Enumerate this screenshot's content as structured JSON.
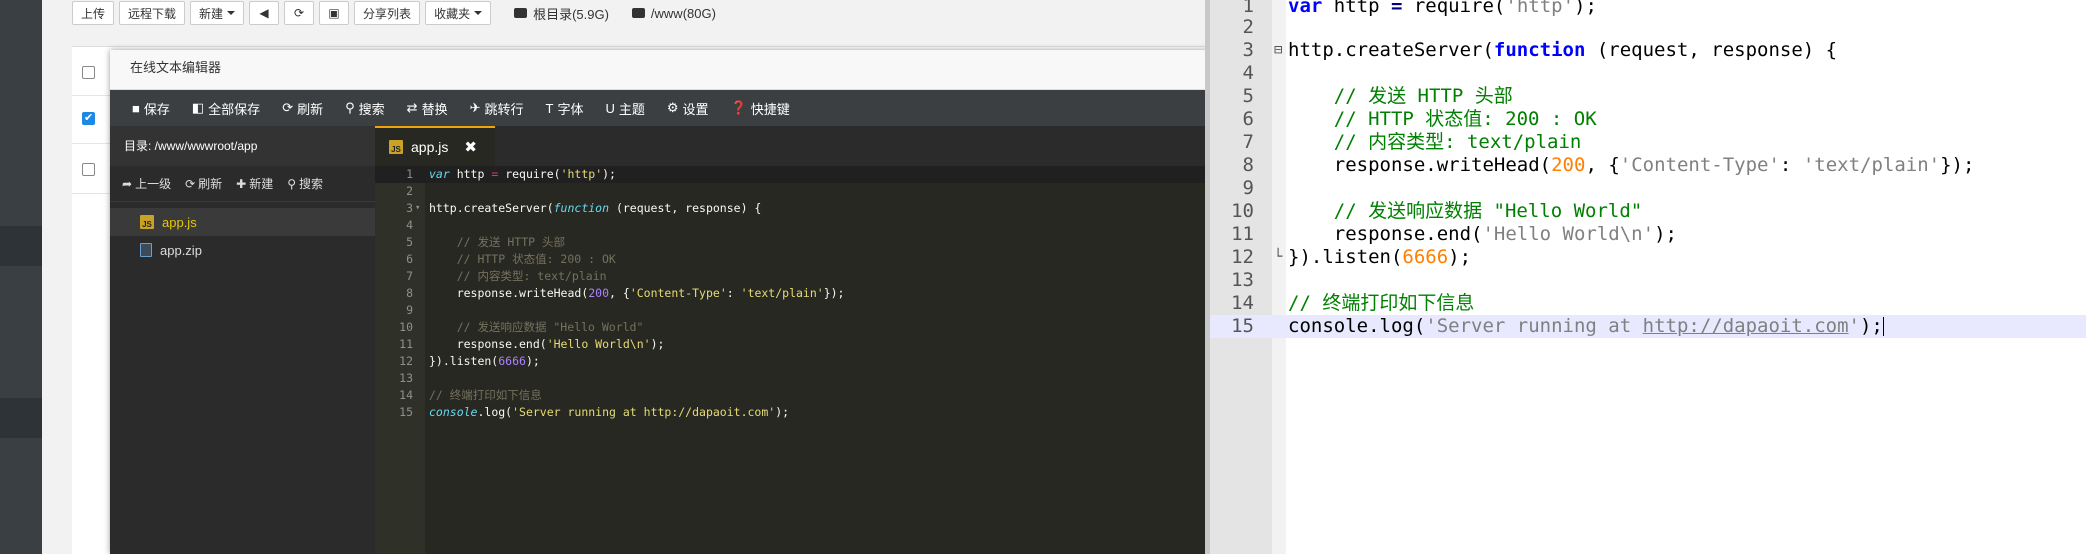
{
  "toolbar": {
    "upload": "上传",
    "remote_download": "远程下载",
    "new": "新建",
    "share_list": "分享列表",
    "favorites": "收藏夹",
    "root_dir": "根目录(5.9G)",
    "www_dir": "/www(80G)"
  },
  "editor": {
    "title": "在线文本编辑器",
    "menu": {
      "save": "保存",
      "save_all": "全部保存",
      "refresh": "刷新",
      "search": "搜索",
      "replace": "替换",
      "goto_line": "跳转行",
      "font": "字体",
      "theme": "主题",
      "settings": "设置",
      "shortcuts": "快捷键"
    },
    "sidebar": {
      "dir_label": "目录: /www/wwwroot/app",
      "up": "上一级",
      "refresh": "刷新",
      "new": "新建",
      "search": "搜索",
      "files": [
        "app.js",
        "app.zip"
      ]
    },
    "tab": {
      "name": "app.js"
    }
  },
  "code_lines": [
    "var http = require('http');",
    "",
    "http.createServer(function (request, response) {",
    "",
    "    // 发送 HTTP 头部",
    "    // HTTP 状态值: 200 : OK",
    "    // 内容类型: text/plain",
    "    response.writeHead(200, {'Content-Type': 'text/plain'});",
    "",
    "    // 发送响应数据 \"Hello World\"",
    "    response.end('Hello World\\n');",
    "}).listen(6666);",
    "",
    "// 终端打印如下信息",
    "console.log('Server running at http://dapaoit.com');"
  ],
  "line_numbers": [
    "1",
    "2",
    "3",
    "4",
    "5",
    "6",
    "7",
    "8",
    "9",
    "10",
    "11",
    "12",
    "13",
    "14",
    "15"
  ],
  "colors": {
    "editor_bg": "#272822",
    "menu_bg": "#3c3f41",
    "accent_tab": "#f0a30a",
    "checkbox_checked": "#1e88e5"
  }
}
